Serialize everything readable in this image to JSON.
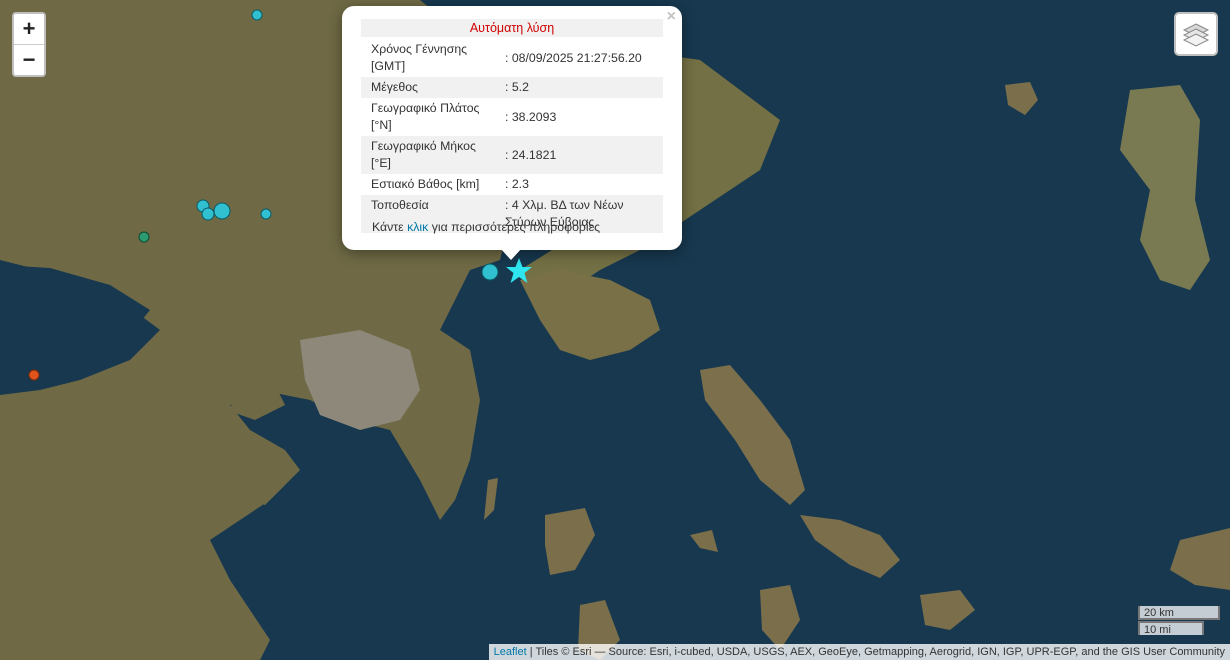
{
  "map": {
    "land_color": "#6f6a45",
    "sea_color": "#17384f",
    "markers": [
      {
        "name": "quake-marker",
        "lat": 38.2093,
        "lon": 24.1821,
        "shape": "star",
        "color": "#2fe6f0"
      },
      {
        "name": "quake-marker",
        "shape": "circle",
        "color": "#30c0d0"
      },
      {
        "name": "quake-marker",
        "shape": "circle",
        "color": "#30c0d0"
      },
      {
        "name": "quake-marker",
        "shape": "circle",
        "color": "#2e9a70"
      },
      {
        "name": "quake-marker",
        "shape": "circle",
        "color": "#e0531c"
      }
    ]
  },
  "controls": {
    "zoom_in": "+",
    "zoom_out": "−",
    "layers_icon": "layers-icon"
  },
  "popup": {
    "close": "×",
    "title": "Αυτόματη λύση",
    "rows": [
      {
        "label": "Χρόνος Γέννησης [GMT]",
        "value": ": 08/09/2025 21:27:56.20"
      },
      {
        "label": "Μέγεθος",
        "value": ": 5.2"
      },
      {
        "label": "Γεωγραφικό Πλάτος [°N]",
        "value": ": 38.2093"
      },
      {
        "label": "Γεωγραφικό Μήκος [°E]",
        "value": ": 24.1821"
      },
      {
        "label": "Εστιακό Βάθος [km]",
        "value": ": 2.3"
      },
      {
        "label": "Τοποθεσία",
        "value": ": 4 Χλμ. ΒΔ των Νέων Στύρων Εύβοιας"
      }
    ],
    "more_prefix": "Κάντε",
    "more_link": "κλικ",
    "more_suffix": "για περισσότερες πληροφορίες"
  },
  "scale": {
    "km": "20 km",
    "mi": "10 mi"
  },
  "attribution": {
    "leaflet": "Leaflet",
    "text": "| Tiles © Esri — Source: Esri, i-cubed, USDA, USGS, AEX, GeoEye, Getmapping, Aerogrid, IGN, IGP, UPR-EGP, and the GIS User Community"
  }
}
